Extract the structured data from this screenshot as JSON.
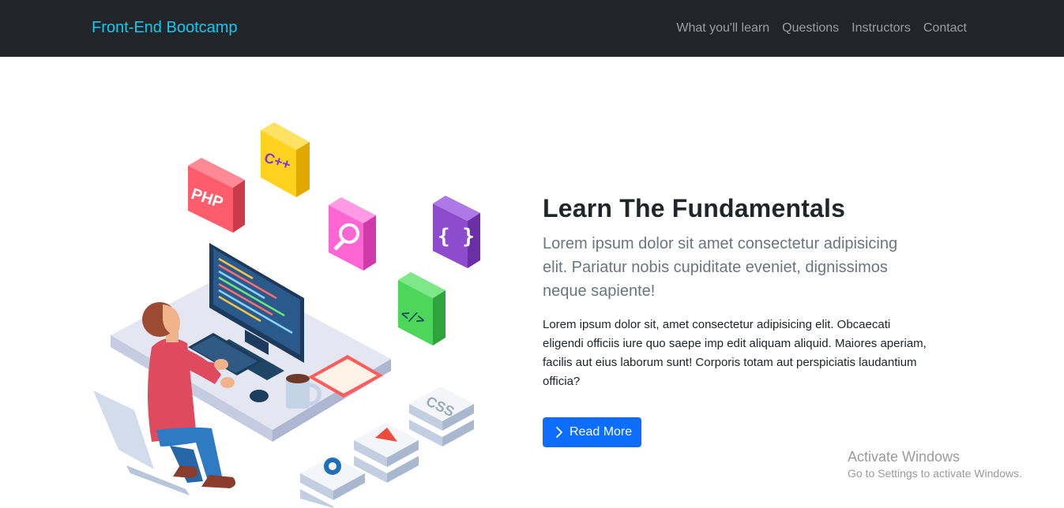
{
  "navbar": {
    "brand": "Front-End Bootcamp",
    "links": [
      "What you'll learn",
      "Questions",
      "Instructors",
      "Contact"
    ]
  },
  "hero": {
    "title": "Learn The Fundamentals",
    "lead": "Lorem ipsum dolor sit amet consectetur adipisicing elit. Pariatur nobis cupiditate eveniet, dignissimos neque sapiente!",
    "body": "Lorem ipsum dolor sit, amet consectetur adipisicing elit. Obcaecati eligendi officiis iure quo saepe imp edit aliquam aliquid. Maiores aperiam, facilis aut eius laborum sunt! Corporis totam aut perspiciatis laudantium officia?",
    "button_label": "Read More",
    "button_icon": "chevron-right-icon"
  },
  "illustration": {
    "cube_labels": {
      "php": "PHP",
      "cpp": "C++",
      "braces": "{ }",
      "code": "</>",
      "css": "CSS"
    }
  },
  "watermark": {
    "title": "Activate Windows",
    "subtitle": "Go to Settings to activate Windows."
  },
  "colors": {
    "navbar_bg": "#212529",
    "brand": "#0dcaf0",
    "primary": "#0d6efd"
  }
}
